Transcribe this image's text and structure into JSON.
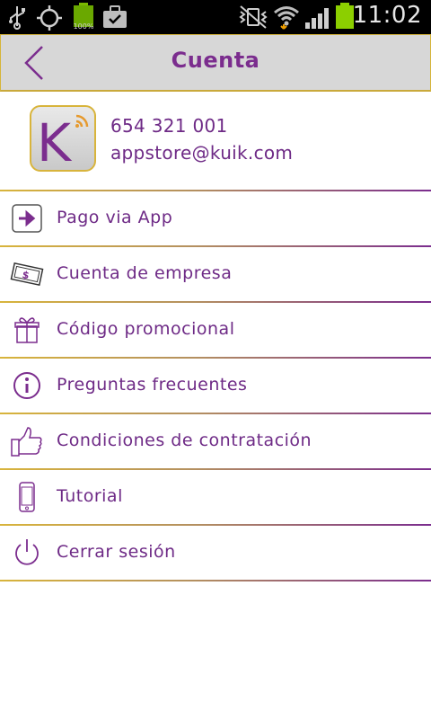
{
  "status_bar": {
    "time": "11:02",
    "battery_left_label": "100%",
    "icons": [
      "usb-icon",
      "gps-icon",
      "battery-icon",
      "briefcase-icon",
      "vibrate-icon",
      "wifi-icon",
      "signal-icon",
      "battery-icon"
    ]
  },
  "header": {
    "title": "Cuenta",
    "back_icon": "chevron-left-icon"
  },
  "profile": {
    "logo_letter": "K",
    "phone": "654 321 001",
    "email": "appstore@kuik.com"
  },
  "menu": {
    "items": [
      {
        "label": "Pago via App",
        "icon": "arrow-box-icon"
      },
      {
        "label": "Cuenta de empresa",
        "icon": "money-icon"
      },
      {
        "label": "Código promocional",
        "icon": "gift-icon"
      },
      {
        "label": "Preguntas frecuentes",
        "icon": "info-icon"
      },
      {
        "label": "Condiciones de contratación",
        "icon": "thumbs-up-icon"
      },
      {
        "label": "Tutorial",
        "icon": "phone-icon"
      },
      {
        "label": "Cerrar sesión",
        "icon": "power-icon"
      }
    ]
  },
  "colors": {
    "accent": "#7b2d8e",
    "gold": "#d8b43c",
    "header_bg": "#d7d7d7"
  }
}
